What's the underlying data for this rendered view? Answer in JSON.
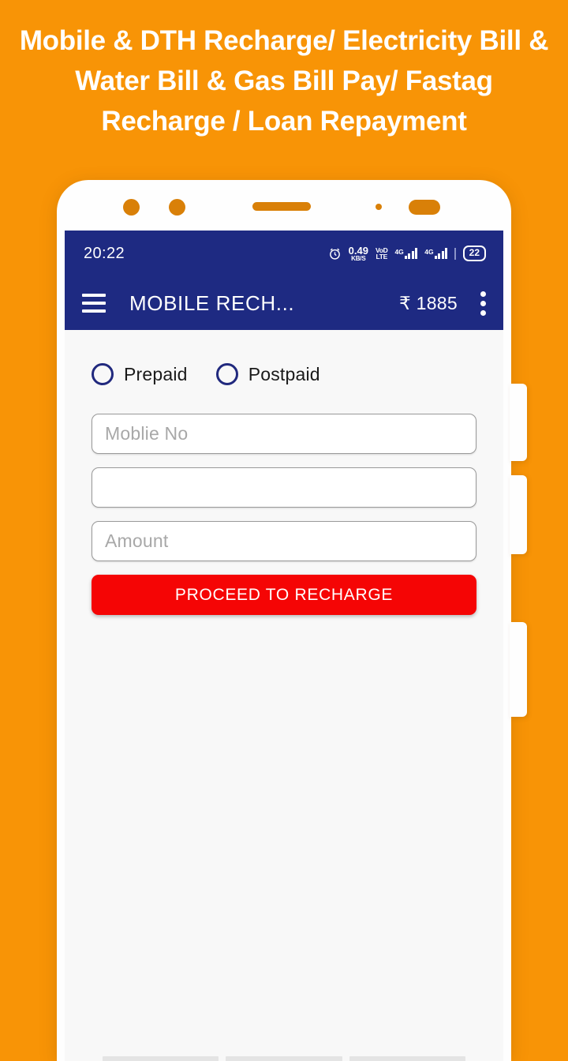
{
  "headline": "Mobile & DTH Recharge/ Electricity Bill & Water Bill & Gas Bill Pay/ Fastag Recharge / Loan Repayment",
  "colors": {
    "background_orange": "#F89406",
    "phone_body": "#FEFEFE",
    "appbar_navy": "#1E2A82",
    "cta_red": "#F50505",
    "screen_bg": "#F8F8F8",
    "bezel_hardware": "#D98008"
  },
  "status_bar": {
    "time": "20:22",
    "alarm_icon": "alarm-clock-icon",
    "net_speed_value": "0.49",
    "net_speed_unit": "KB/S",
    "volte_line1": "VoD",
    "volte_line2": "LTE",
    "sim1_network": "4G",
    "sim2_network": "4G",
    "battery_level": "22"
  },
  "app_bar": {
    "menu_icon": "hamburger-menu-icon",
    "title": "MOBILE RECH...",
    "balance": "₹ 1885",
    "overflow_icon": "kebab-menu-icon"
  },
  "form": {
    "radio_options": [
      {
        "label": "Prepaid",
        "selected": false
      },
      {
        "label": "Postpaid",
        "selected": false
      }
    ],
    "fields": [
      {
        "name": "mobile-number",
        "placeholder": "Moblie No",
        "value": ""
      },
      {
        "name": "operator",
        "placeholder": "",
        "value": ""
      },
      {
        "name": "amount",
        "placeholder": "Amount",
        "value": ""
      }
    ],
    "submit_label": "PROCEED TO RECHARGE"
  },
  "phone_hardware": {
    "side_buttons": 3,
    "sensors": [
      "sensor-dot",
      "sensor-dot",
      "earpiece-speaker",
      "proximity-dot",
      "front-camera"
    ]
  }
}
